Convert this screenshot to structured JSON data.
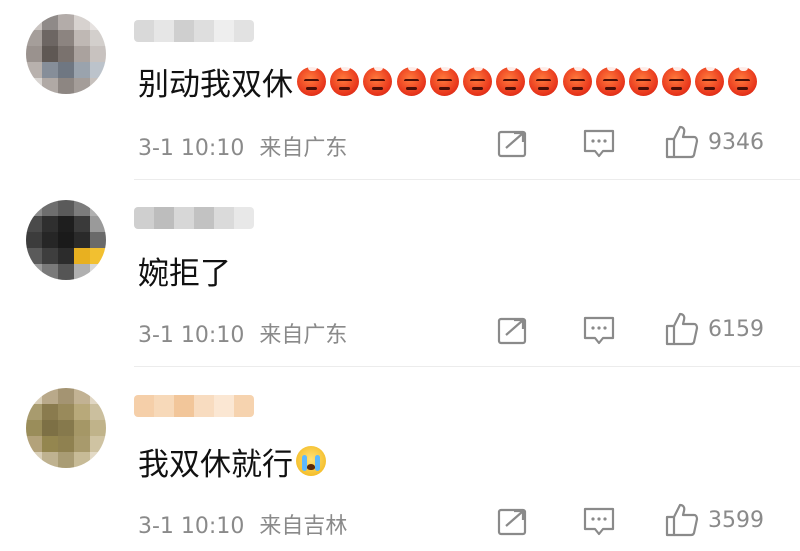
{
  "comments": [
    {
      "content": "别动我双休",
      "emoji": "angry-face-emoji",
      "emoji_count": 14,
      "date": "3-1 10:10",
      "location": "来自广东",
      "likes": "9346",
      "avatar_colors": [
        "#c9c3c0",
        "#8f8a88",
        "#b3aca9",
        "#d7d2cf",
        "#e6e2e0",
        "#a59e9a",
        "#6d6663",
        "#8c8480",
        "#bfb8b4",
        "#d3cfcc",
        "#9a928e",
        "#5f5854",
        "#7a726e",
        "#aaa29e",
        "#c8c2bf",
        "#b8b1ad",
        "#868e99",
        "#6f7782",
        "#9aa3ad",
        "#bcc3cb",
        "#d8d4d1",
        "#b0a9a5",
        "#8d8682",
        "#a49d99",
        "#c6c0bc"
      ],
      "name_colors": [
        "#d9d9d9",
        "#e6e6e6",
        "#cfcfcf",
        "#dedede",
        "#eeeeee",
        "#e2e2e2"
      ]
    },
    {
      "content": "婉拒了",
      "date": "3-1 10:10",
      "location": "来自广东",
      "likes": "6159",
      "avatar_colors": [
        "#8c8c8c",
        "#6e6e6e",
        "#5a5a5a",
        "#7c7c7c",
        "#b0b0b0",
        "#4a4a4a",
        "#2f2f2f",
        "#1e1e1e",
        "#3a3a3a",
        "#9a9a9a",
        "#3c3c3c",
        "#262626",
        "#1a1a1a",
        "#2a2a2a",
        "#6a6a6a",
        "#5a5a5a",
        "#3e3e3e",
        "#2c2c2c",
        "#e8b020",
        "#f2c030",
        "#9c9c9c",
        "#7a7a7a",
        "#555555",
        "#b0b0b0",
        "#d8d8d8"
      ],
      "name_colors": [
        "#cfcfcf",
        "#bdbdbd",
        "#d7d7d7",
        "#c2c2c2",
        "#dadada",
        "#e8e8e8"
      ]
    },
    {
      "content": "我双休就行",
      "emoji": "crying-face-emoji",
      "date": "3-1 10:10",
      "location": "来自吉林",
      "likes": "3599",
      "avatar_colors": [
        "#d8cdb6",
        "#b9a98a",
        "#a49472",
        "#c2b293",
        "#e0d6c3",
        "#a89b6e",
        "#8a7b4e",
        "#998a5b",
        "#b8a97a",
        "#cbbf9e",
        "#9a8d5a",
        "#7d7045",
        "#86794c",
        "#a59766",
        "#c0b38a",
        "#b3a27a",
        "#94864f",
        "#8f8150",
        "#a89a6c",
        "#cfc3a2",
        "#d9cfb8",
        "#bfb290",
        "#a99c74",
        "#c7bb97",
        "#e3dac6"
      ],
      "name_colors": [
        "#f5cfa9",
        "#f7d9b9",
        "#f2c69a",
        "#f8dcc0",
        "#fbe7d3",
        "#f6d3af"
      ]
    }
  ],
  "icons": {
    "share": "share-icon",
    "comment": "comment-icon",
    "like": "thumbs-up-icon"
  }
}
